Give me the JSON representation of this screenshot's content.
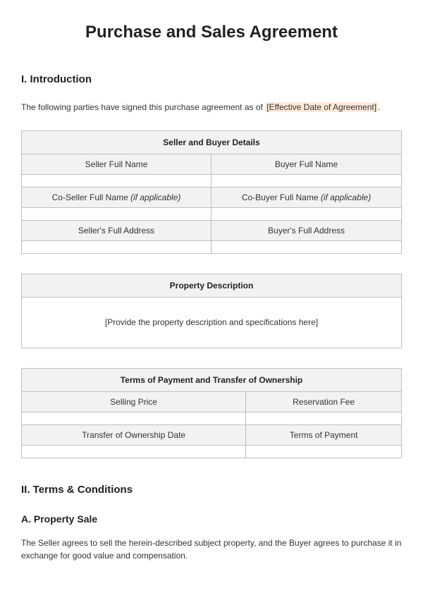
{
  "title": "Purchase and Sales Agreement",
  "section1": {
    "heading": "I. Introduction",
    "intro_prefix": "The following parties have signed this purchase agreement as of ",
    "intro_placeholder": "[Effective Date of Agreement]",
    "intro_suffix": "."
  },
  "table1": {
    "header": "Seller and Buyer Details",
    "seller_name_label": "Seller Full Name",
    "buyer_name_label": "Buyer Full Name",
    "coseller_prefix": "Co-Seller Full Name ",
    "coseller_suffix": "(if applicable)",
    "cobuyer_prefix": "Co-Buyer Full Name ",
    "cobuyer_suffix": "(if applicable)",
    "seller_addr_label": "Seller's Full Address",
    "buyer_addr_label": "Buyer's Full Address"
  },
  "table2": {
    "header": "Property Description",
    "body": "[Provide the property description and specifications here]"
  },
  "table3": {
    "header": "Terms of Payment and Transfer of Ownership",
    "selling_price_label": "Selling Price",
    "reservation_fee_label": "Reservation Fee",
    "transfer_date_label": "Transfer of Ownership Date",
    "payment_terms_label": "Terms of Payment"
  },
  "section2": {
    "heading": "II. Terms & Conditions",
    "sub_a_heading": "A. Property Sale",
    "sub_a_body": "The Seller agrees to sell the herein-described subject property, and the Buyer agrees to purchase it in exchange for good value and compensation."
  }
}
